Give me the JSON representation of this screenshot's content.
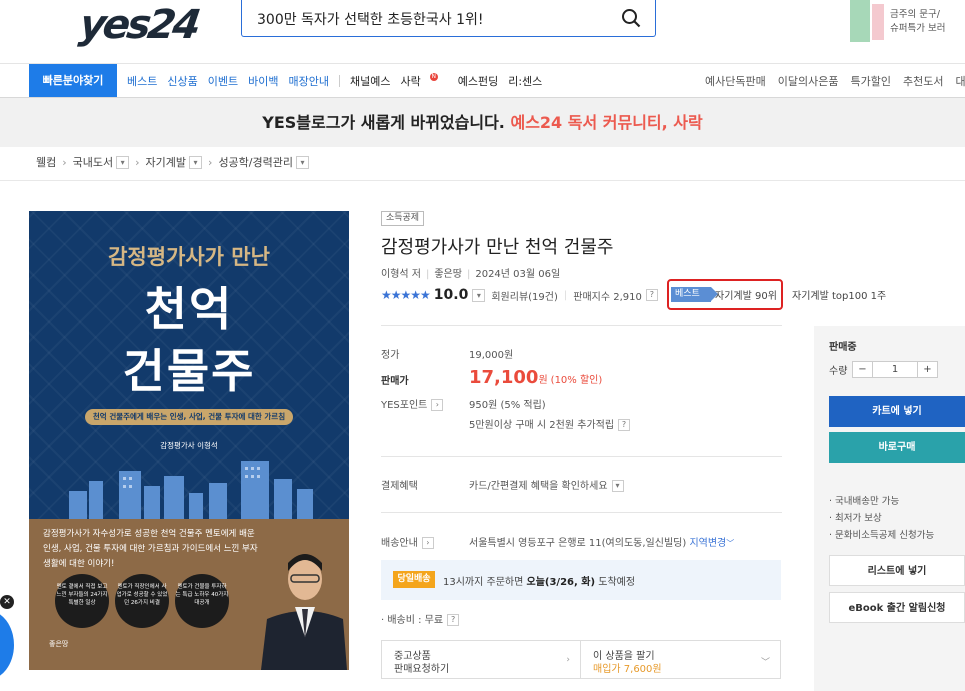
{
  "header": {
    "logo": "yes24",
    "search_query": "300만 독자가 선택한 초등한국사 1위!",
    "promo_line1": "금주의 문구/",
    "promo_line2": "슈퍼특가 보러"
  },
  "nav": {
    "quick_find": "빠른분야찾기",
    "left_items": [
      "베스트",
      "신상품",
      "이벤트",
      "바이백",
      "매장안내"
    ],
    "mid_items": [
      "채널예스",
      "사락",
      "예스펀딩",
      "리:센스"
    ],
    "new_badge": "N",
    "right_items": [
      "예사단독판매",
      "이달의사은품",
      "특가할인",
      "추천도서",
      "대량"
    ]
  },
  "banner": {
    "text": "YES블로그가 새롭게 바뀌었습니다.",
    "highlight": "예스24 독서 커뮤니티, 사락"
  },
  "breadcrumb": [
    "웰컴",
    "국내도서",
    "자기계발",
    "성공학/경력관리"
  ],
  "cover": {
    "subtitle": "감정평가사가 만난",
    "title_line1": "천억",
    "title_line2": "건물주",
    "tagline": "천억 건물주에게 배우는 인생, 사업, 건물 투자에 대한 가르침",
    "author": "감정평가사 이형석",
    "desc": "감정평가사가 자수성가로 성공한 천억 건물주 멘토에게 배운 인생, 사업, 건물 투자에 대한 가르침과 가이드에서 느낀 부자 생활에 대한 이야기!",
    "circles": [
      "멘토 곁에서 직접 보고 느낀 부자들의 24가지 특별한 일상",
      "멘토가 직장인에서 사업가로 성공할 수 있었던 26가지 비결",
      "멘토가 건물을 투자하는 특급 노하우 40가지 대공개"
    ],
    "publisher": "좋은땅"
  },
  "product": {
    "tag": "소득공제",
    "title": "감정평가사가 만난 천억 건물주",
    "author": "이형석 저",
    "publisher": "좋은땅",
    "date": "2024년 03월 06일",
    "stars": "★★★★★",
    "score": "10.0",
    "reviews": "회원리뷰(19건)",
    "sales_index": "판매지수 2,910",
    "best_label": "베스트",
    "best_rank": "자기계발 90위",
    "top100": "자기계발 top100 1주"
  },
  "pricing": {
    "list_label": "정가",
    "list_price": "19,000원",
    "sale_label": "판매가",
    "sale_price": "17,100",
    "won": "원",
    "discount": "(10% 할인)",
    "point_label": "YES포인트",
    "point_value": "950원 (5% 적립)",
    "point_extra": "5만원이상 구매 시 2천원 추가적립"
  },
  "payment": {
    "label": "결제혜택",
    "value": "카드/간편결제 혜택을 확인하세요"
  },
  "shipping": {
    "label": "배송안내",
    "address": "서울특별시 영등포구 은행로 11(여의도동,일신빌딩)",
    "change": "지역변경",
    "today_badge": "당일배송",
    "today_text": "13시까지 주문하면",
    "today_bold": "오늘(3/26, 화)",
    "today_tail": "도착예정",
    "fee": "· 배송비 : 무료"
  },
  "bottom": {
    "used_line1": "중고상품",
    "used_line2": "판매요청하기",
    "sell_line1": "이 상품을 팔기",
    "sell_line2": "매입가 7,600원"
  },
  "panel": {
    "status": "판매중",
    "qty_label": "수량",
    "qty": "1",
    "cart": "카트에 넣기",
    "buy": "바로구매",
    "benefits": [
      "· 국내배송만 가능",
      "· 최저가 보상",
      "· 문화비소득공제 신청가능"
    ],
    "wishlist": "리스트에 넣기",
    "ebook": "eBook 출간 알림신청"
  },
  "colors": {
    "accent": "#1e7ce8",
    "price": "#ea4b3c",
    "cart": "#1f63c2",
    "buy": "#2aa2aa"
  }
}
